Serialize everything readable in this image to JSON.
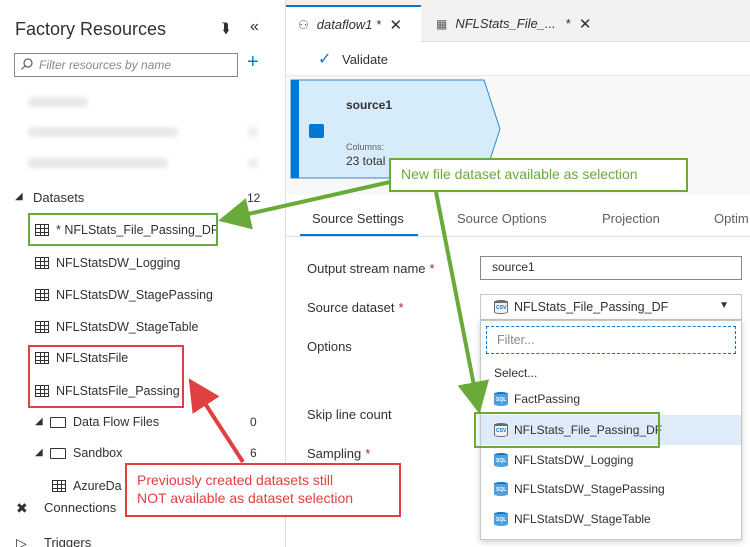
{
  "left_panel": {
    "title": "Factory Resources",
    "filter_placeholder": "Filter resources by name",
    "datasets_header": "Datasets",
    "datasets_count": "12",
    "datasets": [
      "* NFLStats_File_Passing_DF",
      "NFLStatsDW_Logging",
      "NFLStatsDW_StagePassing",
      "NFLStatsDW_StageTable",
      "NFLStatsFile",
      "NFLStatsFile_Passing"
    ],
    "folders": [
      {
        "label": "Data Flow Files",
        "count": "0"
      },
      {
        "label": "Sandbox",
        "count": "6"
      }
    ],
    "sandbox_child": "AzureDa",
    "bottom_items": [
      "Connections",
      "Triggers"
    ]
  },
  "tabs": [
    {
      "label": "dataflow1",
      "modified": "*"
    },
    {
      "label": "NFLStats_File_...",
      "modified": "*"
    }
  ],
  "toolbar": {
    "validate": "Validate"
  },
  "node": {
    "title": "source1",
    "columns_label": "Columns:",
    "columns_total": "23 total"
  },
  "settings_tabs": [
    "Source Settings",
    "Source Options",
    "Projection",
    "Optim"
  ],
  "form": {
    "output_stream_label": "Output stream name",
    "output_stream_value": "source1",
    "source_dataset_label": "Source dataset",
    "source_dataset_value": "NFLStats_File_Passing_DF",
    "options_label": "Options",
    "skip_line_label": "Skip line count",
    "sampling_label": "Sampling",
    "required_mark": "*"
  },
  "dropdown": {
    "filter_placeholder": "Filter...",
    "placeholder": "Select...",
    "items": [
      "FactPassing",
      "NFLStats_File_Passing_DF",
      "NFLStatsDW_Logging",
      "NFLStatsDW_StagePassing",
      "NFLStatsDW_StageTable"
    ]
  },
  "annotations": {
    "green": "New file dataset available as selection",
    "red_line1": "Previously created datasets still",
    "red_line2": "NOT available as dataset selection"
  },
  "colors": {
    "accent": "#0078d4",
    "annotation_green": "#6aaa3a",
    "annotation_red": "#e04040"
  }
}
